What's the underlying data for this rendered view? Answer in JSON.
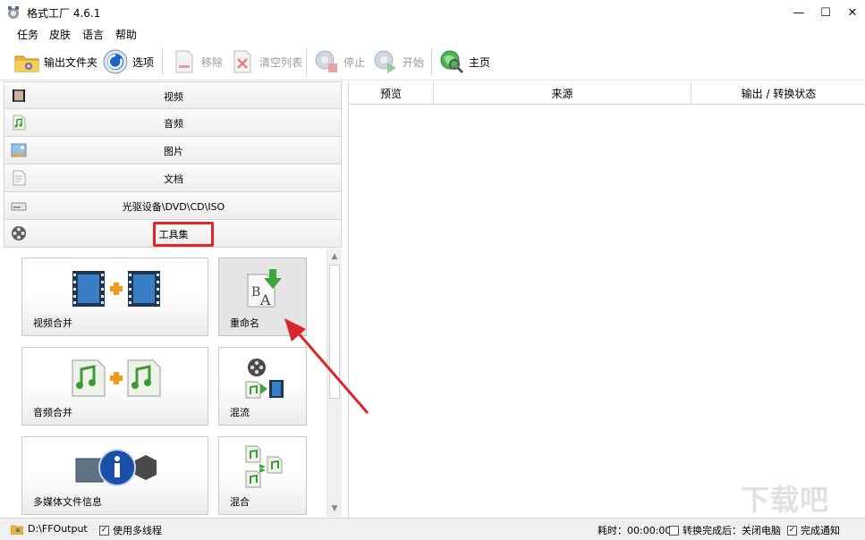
{
  "window": {
    "title": "格式工厂 4.6.1",
    "minimize": "—",
    "maximize": "☐",
    "close": "✕"
  },
  "menu": [
    "任务",
    "皮肤",
    "语言",
    "帮助"
  ],
  "toolbar": {
    "output_folder": "输出文件夹",
    "options": "选项",
    "remove": "移除",
    "clear_list": "清空列表",
    "stop": "停止",
    "start": "开始",
    "home": "主页"
  },
  "categories": [
    {
      "label": "视频",
      "icon": "video-clapper-icon"
    },
    {
      "label": "音频",
      "icon": "audio-note-icon"
    },
    {
      "label": "图片",
      "icon": "picture-icon"
    },
    {
      "label": "文档",
      "icon": "document-icon"
    },
    {
      "label": "光驱设备\\DVD\\CD\\ISO",
      "icon": "optical-drive-icon"
    },
    {
      "label": "工具集",
      "icon": "film-reel-icon"
    }
  ],
  "tools": [
    {
      "label": "视频合并",
      "icon": "video-merge-icon"
    },
    {
      "label": "重命名",
      "icon": "rename-icon"
    },
    {
      "label": "音频合并",
      "icon": "audio-merge-icon"
    },
    {
      "label": "混流",
      "icon": "mux-icon"
    },
    {
      "label": "多媒体文件信息",
      "icon": "media-info-icon"
    },
    {
      "label": "混合",
      "icon": "mix-icon"
    }
  ],
  "list_columns": [
    "预览",
    "来源",
    "输出 / 转换状态"
  ],
  "status": {
    "output_path": "D:\\FFOutput",
    "multithread_label": "使用多线程",
    "multithread_checked": true,
    "elapsed": "耗时：00:00:00",
    "after_complete": "转换完成后：关闭电脑",
    "after_complete_checked": false,
    "notify": "完成通知",
    "notify_checked": true
  },
  "watermark": "下载吧",
  "colors": {
    "highlight": "#e2252b",
    "arrow": "#d9262c"
  }
}
